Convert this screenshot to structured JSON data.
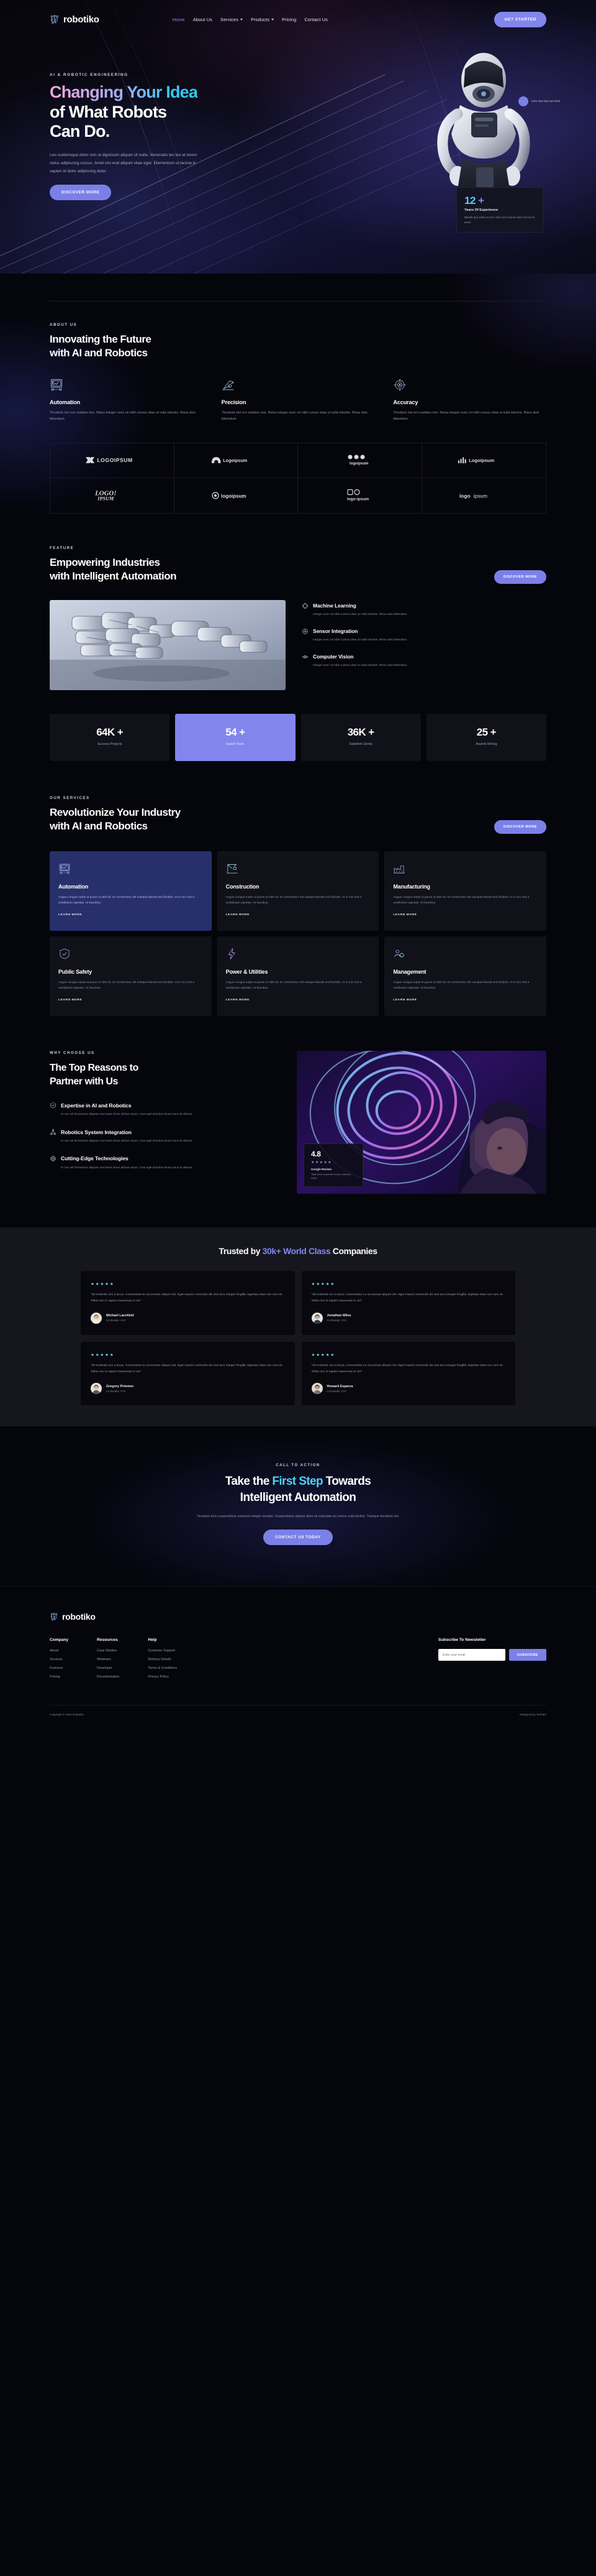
{
  "brand": {
    "name": "robotiko",
    "mark_icon": "circuit-node-icon"
  },
  "nav": {
    "links": [
      {
        "label": "Home",
        "active": true,
        "dropdown": false
      },
      {
        "label": "About Us",
        "active": false,
        "dropdown": false
      },
      {
        "label": "Services",
        "active": false,
        "dropdown": true
      },
      {
        "label": "Products",
        "active": false,
        "dropdown": true
      },
      {
        "label": "Pricing",
        "active": false,
        "dropdown": false
      },
      {
        "label": "Contact Us",
        "active": false,
        "dropdown": false
      }
    ],
    "cta_label": "GET STARTED"
  },
  "hero": {
    "eyebrow": "AI & ROBOTIC ENGINEERING",
    "title_line1_grad": "Changing Your Idea",
    "title_line2": "of What Robots",
    "title_line3": "Can Do.",
    "paragraph": "Leo scelerisque dolor non ut dignissim aliquet sit nulla. Venenatis leo leo et lorem netus adipiscing cursus. Amet nisi erat aliquet vitae eget. Elementum ut lacinia in sapien id dolor adipiscing dolor.",
    "button_label": "DISCOVER MORE",
    "bubble_text": "Let's see how we work",
    "stat_number": "12",
    "stat_plus": "+",
    "stat_label": "Years Of Experience",
    "stat_desc": "Blandit quis tellus at sem nibh nunc mauris dolor at sed sit amet."
  },
  "about": {
    "eyebrow": "ABOUT US",
    "title_line1": "Innovating the Future",
    "title_line2": "with AI and Robotics",
    "features": [
      {
        "icon": "monitor-chart-icon",
        "title": "Automation",
        "desc": "Tincidunt nisi orci sodales non. Netus integer nunc mi nibh cursus vitae ut nulla lobortis. Risus duis bibendum."
      },
      {
        "icon": "robot-arm-icon",
        "title": "Precision",
        "desc": "Tincidunt nisi orci sodales non. Netus integer nunc mi nibh cursus vitae ut nulla lobortis. Risus duis bibendum."
      },
      {
        "icon": "target-crosshair-icon",
        "title": "Accuracy",
        "desc": "Tincidunt nisi orci sodales non. Netus integer nunc mi nibh cursus vitae ut nulla lobortis. Risus duis bibendum."
      }
    ]
  },
  "logos": [
    {
      "name": "LOGOIPSUM",
      "style": "caps-arrow"
    },
    {
      "name": "Logoipsum",
      "style": "arch"
    },
    {
      "name": "logoipsum",
      "style": "dots"
    },
    {
      "name": "Logoipsum",
      "style": "bars"
    },
    {
      "name": "LOGO IPSUM",
      "style": "script"
    },
    {
      "name": "logoipsum",
      "style": "hex"
    },
    {
      "name": "logo ipsum",
      "style": "square"
    },
    {
      "name": "logo ipsum",
      "style": "plain"
    }
  ],
  "feature": {
    "eyebrow": "FEATURE",
    "title_line1": "Empowering Industries",
    "title_line2": "with Intelligent Automation",
    "button_label": "DISCOVER MORE",
    "items": [
      {
        "icon": "cpu-icon",
        "title": "Machine Learning",
        "desc": "Integer nunc mi nibh cursus vitae ut nulla lobortis. Risus duis bibendum."
      },
      {
        "icon": "sensor-icon",
        "title": "Sensor Integration",
        "desc": "Integer nunc mi nibh cursus vitae ut nulla lobortis. Risus duis bibendum."
      },
      {
        "icon": "eye-icon",
        "title": "Computer Vision",
        "desc": "Integer nunc mi nibh cursus vitae ut nulla lobortis. Risus duis bibendum."
      }
    ]
  },
  "stats": [
    {
      "number": "64K +",
      "label": "Success Projects",
      "accent": false
    },
    {
      "number": "54 +",
      "label": "Expert Team",
      "accent": true
    },
    {
      "number": "36K +",
      "label": "Satisfied Clients",
      "accent": false
    },
    {
      "number": "25 +",
      "label": "Awards Wining",
      "accent": false
    }
  ],
  "services": {
    "eyebrow": "OUR SERVICES",
    "title_line1": "Revolutionize Your Industry",
    "title_line2": "with AI and Robotics",
    "button_label": "DISCOVER MORE",
    "link_label": "LEARN MORE",
    "cards": [
      {
        "icon": "monitor-chart-icon",
        "title": "Automation",
        "accent": true,
        "desc": "Augue congue turpis ut purus ut nibh sit. Et consectetur elit volutpat blandit sed facilisis. At in orci sed a vestibulum egestas. Ut faucibus."
      },
      {
        "icon": "crane-icon",
        "title": "Construction",
        "accent": false,
        "desc": "Augue congue turpis ut purus ut nibh sit. Et consectetur elit volutpat blandit sed facilisis. At in orci sed a vestibulum egestas. Ut faucibus."
      },
      {
        "icon": "factory-icon",
        "title": "Manufacturing",
        "accent": false,
        "desc": "Augue congue turpis ut purus ut nibh sit. Et consectetur elit volutpat blandit sed facilisis. At in orci sed a vestibulum egestas. Ut faucibus."
      },
      {
        "icon": "shield-icon",
        "title": "Public Safety",
        "accent": false,
        "desc": "Augue congue turpis ut purus ut nibh sit. Et consectetur elit volutpat blandit sed facilisis. At in orci sed a vestibulum egestas. Ut faucibus."
      },
      {
        "icon": "bolt-icon",
        "title": "Power & Utilities",
        "accent": false,
        "desc": "Augue congue turpis ut purus ut nibh sit. Et consectetur elit volutpat blandit sed facilisis. At in orci sed a vestibulum egestas. Ut faucibus."
      },
      {
        "icon": "gear-people-icon",
        "title": "Management",
        "accent": false,
        "desc": "Augue congue turpis ut purus ut nibh sit. Et consectetur elit volutpat blandit sed facilisis. At in orci sed a vestibulum egestas. Ut faucibus."
      }
    ]
  },
  "why": {
    "eyebrow": "WHY CHOOSE US",
    "title_line1": "The Top Reasons to",
    "title_line2": "Partner with Us",
    "items": [
      {
        "icon": "check-badge-icon",
        "title": "Expertise in AI and Robotics",
        "desc": "In non vel fermentum aliquam sed amet lorem ultrices lacus. Cras eget tincidunt lectus risus id ultrices."
      },
      {
        "icon": "network-icon",
        "title": "Robotics System Integration",
        "desc": "In non vel fermentum aliquam sed amet lorem ultrices lacus. Cras eget tincidunt lectus risus id ultrices."
      },
      {
        "icon": "chip-icon",
        "title": "Cutting-Edge Technologies",
        "desc": "In non vel fermentum aliquam sed amet lorem ultrices lacus. Cras eget tincidunt lectus risus id ultrices."
      }
    ],
    "rating_value": "4.8",
    "rating_stars": "★★★★★",
    "rating_name": "Google Review",
    "rating_sub": "Total future powered tourism ultimate dollar"
  },
  "testimonials": {
    "heading_pre": "Trusted by ",
    "heading_accent": "30k+ World Class",
    "heading_post": " Companies",
    "stars": "★★★★★",
    "cards": [
      {
        "text": "\"Sit molestie orci a lacus. Consectetur eu accumsan aliquet nisi. Eget mauris commodo dis sed arcu integer fringilla. Egestas vitae non cum sit. Tellus nec in sapien maecenas in vel.\"",
        "name": "Michael Lacefield",
        "role": "Co-founder, XYZ"
      },
      {
        "text": "\"Sit molestie orci a lacus. Consectetur eu accumsan aliquet nisi. Eget mauris commodo dis sed arcu integer fringilla. Egestas vitae non cum sit. Tellus nec in sapien maecenas in vel.\"",
        "name": "Jonathan Miles",
        "role": "Co-founder, XYZ"
      },
      {
        "text": "\"Sit molestie orci a lacus. Consectetur eu accumsan aliquet nisi. Eget mauris commodo dis sed arcu integer fringilla. Egestas vitae non cum sit. Tellus nec in sapien maecenas in vel.\"",
        "name": "Gregory Primmer",
        "role": "Co-founder, XYZ"
      },
      {
        "text": "\"Sit molestie orci a lacus. Consectetur eu accumsan aliquet nisi. Eget mauris commodo dis sed arcu integer fringilla. Egestas vitae non cum sit. Tellus nec in sapien maecenas in vel.\"",
        "name": "Howard Esparza",
        "role": "Co-founder, XYZ"
      }
    ]
  },
  "cta": {
    "eyebrow": "CALL TO ACTION",
    "title_pre": "Take the ",
    "title_hl": "First Step",
    "title_post": " Towards",
    "title_line2": "Intelligent Automation",
    "paragraph": "Tincidunt duis suspendisse euismod integer semper. Suspendisse aliquet diam sit vulputate eu metus nulla facilisi. Tristique tincidunt nisi.",
    "button_label": "CONTACT US TODAY"
  },
  "footer": {
    "brand": "robotiko",
    "columns": [
      {
        "heading": "Company",
        "links": [
          "About",
          "Services",
          "Features",
          "Pricing"
        ]
      },
      {
        "heading": "Resources",
        "links": [
          "Case Studies",
          "Webinars",
          "Developer",
          "Documentation"
        ]
      },
      {
        "heading": "Help",
        "links": [
          "Customer Support",
          "Delivery Details",
          "Terms & Conditions",
          "Privacy Policy"
        ]
      }
    ],
    "subscribe_heading": "Subscribe To Newsletter",
    "subscribe_placeholder": "Enter your email",
    "subscribe_button": "SUBSCRIBE",
    "copyright": "Copyright © 2024 Robotiko",
    "credit": "Designed by Techitro"
  },
  "colors": {
    "accent_purple": "#8286ec",
    "accent_cyan": "#4dd2f5",
    "bg_dark": "#05050c",
    "card_dark": "#111119",
    "testimonial_bg": "#16161f"
  }
}
